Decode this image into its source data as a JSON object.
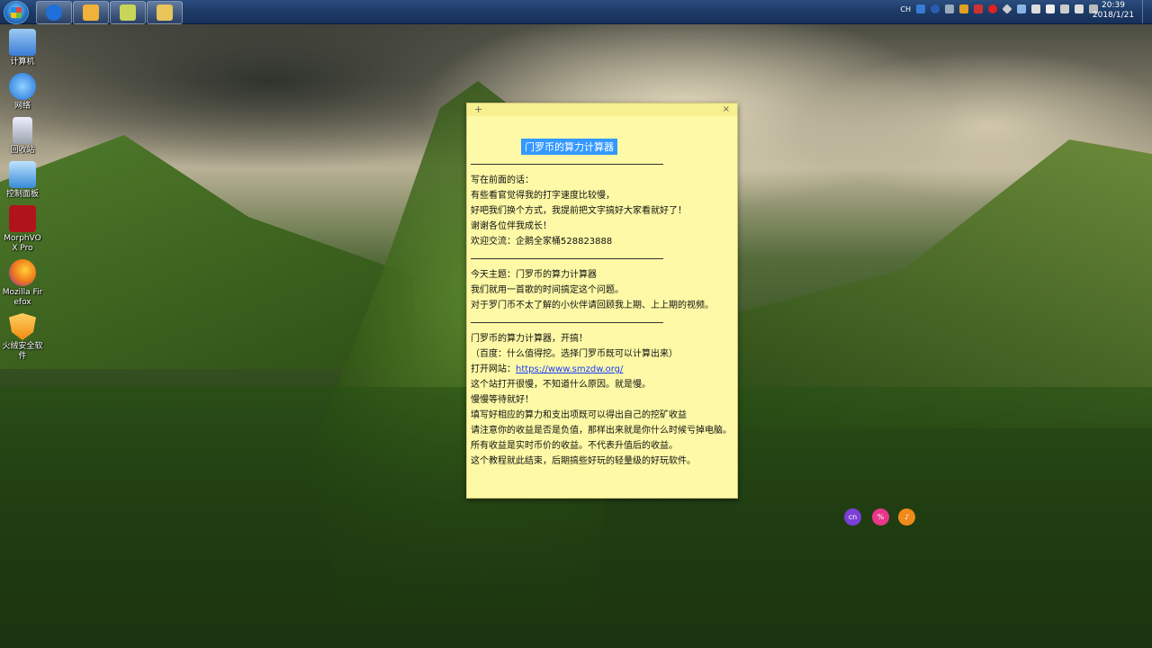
{
  "taskbar": {
    "pinned": [
      {
        "name": "sogou-browser-icon",
        "color": "#1e6fd9"
      },
      {
        "name": "note-app-icon",
        "color": "#f0b23a"
      },
      {
        "name": "sticky-notes-icon",
        "color": "#c9d45a"
      },
      {
        "name": "file-explorer-icon",
        "color": "#e8c45a"
      }
    ],
    "tray_lang": "CH",
    "clock_time": "20:39",
    "clock_date": "2018/1/21"
  },
  "desktop_icons": [
    {
      "name": "computer",
      "label": "计算机",
      "color": "#6aa8e8"
    },
    {
      "name": "network",
      "label": "网络",
      "color": "#3a8ad8"
    },
    {
      "name": "recycle-bin",
      "label": "回收站",
      "color": "#c9ccd0"
    },
    {
      "name": "control-panel",
      "label": "控制面板",
      "color": "#4aa0d8"
    },
    {
      "name": "morphvox",
      "label": "MorphVOX Pro",
      "color": "#b0141a"
    },
    {
      "name": "firefox",
      "label": "Mozilla Firefox",
      "color": "#f07a1a"
    },
    {
      "name": "huorong",
      "label": "火绒安全软件",
      "color": "#f0a020"
    }
  ],
  "note": {
    "title": "门罗币的算力计算器",
    "section1": [
      "写在前面的话：",
      "有些看官觉得我的打字速度比较慢，",
      "好吧我们换个方式，我提前把文字搞好大家看就好了！",
      "谢谢各位伴我成长！",
      "欢迎交流：企鹅全家桶528823888"
    ],
    "section2": [
      "今天主题：门罗币的算力计算器",
      "我们就用一首歌的时间搞定这个问题。",
      "对于罗门币不太了解的小伙伴请回顾我上期、上上期的视频。"
    ],
    "section3_pre": [
      "门罗币的算力计算器，开搞！",
      "（百度：什么值得挖。选择门罗币既可以计算出来）"
    ],
    "site_prefix": "打开网站：",
    "site_url": "https://www.smzdw.org/",
    "section3_post": [
      "这个站打开很慢，不知道什么原因。就是慢。",
      "慢慢等待就好！",
      "填写好相应的算力和支出项既可以得出自己的挖矿收益",
      "请注意你的收益是否是负值，那样出来就是你什么时候亏掉电脑。",
      "所有收益是实时币价的收益。不代表升值后的收益。",
      "这个教程就此结束，后期搞些好玩的轻量级的好玩软件。"
    ]
  },
  "floating_bubbles": [
    {
      "name": "cn-bubble",
      "label": "cn",
      "color": "#7b3fd8"
    },
    {
      "name": "pink-bubble",
      "label": "%",
      "color": "#e8368a"
    },
    {
      "name": "mic-bubble",
      "label": "♪",
      "color": "#f08a1a"
    }
  ]
}
